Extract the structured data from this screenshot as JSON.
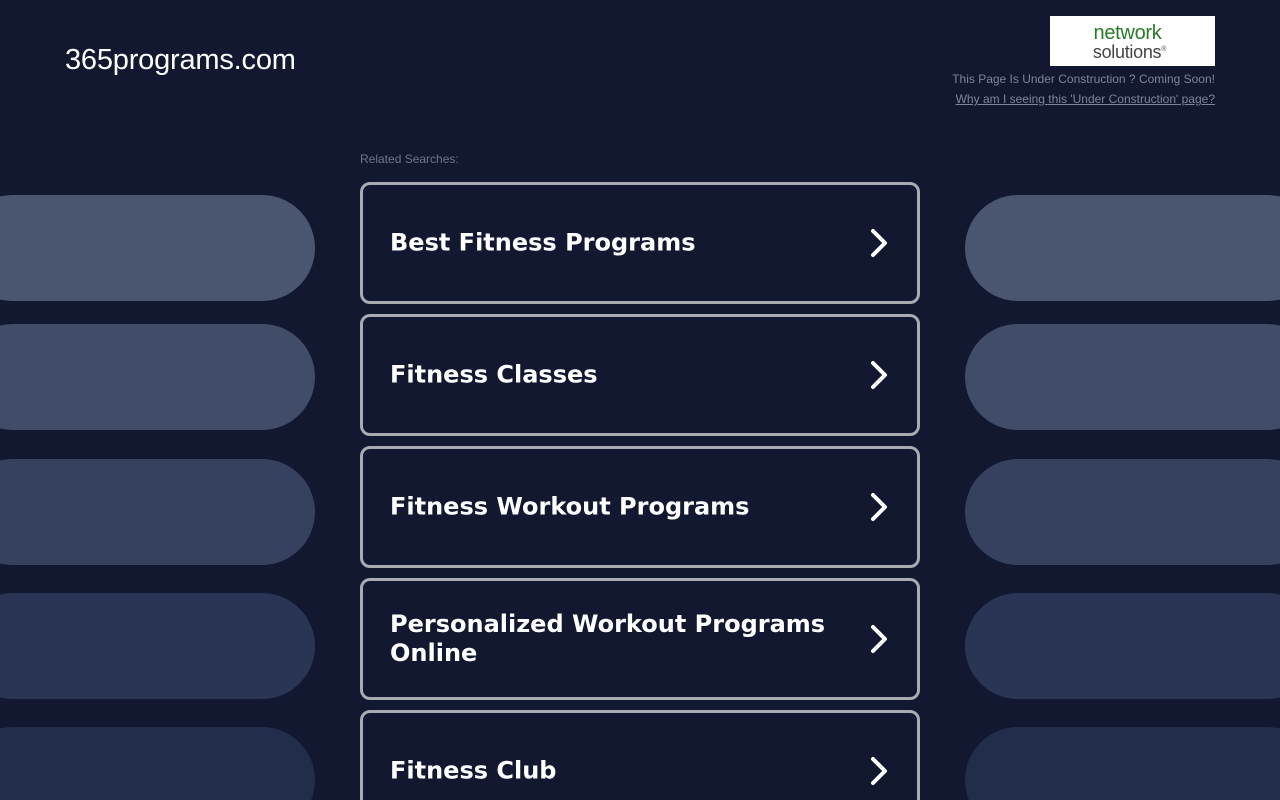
{
  "header": {
    "domain": "365programs.com",
    "logo": {
      "line1": "network",
      "line2": "solutions",
      "mark": "®"
    },
    "under_construction": "This Page Is Under Construction ? Coming Soon!",
    "why_link": "Why am I seeing this 'Under Construction' page?"
  },
  "related_label": "Related Searches:",
  "results": [
    {
      "label": "Best Fitness Programs",
      "icon": "chevron-right-icon"
    },
    {
      "label": "Fitness Classes",
      "icon": "chevron-right-icon"
    },
    {
      "label": "Fitness Workout Programs",
      "icon": "chevron-right-icon"
    },
    {
      "label": "Personalized Workout Programs Online",
      "icon": "chevron-right-icon"
    },
    {
      "label": "Fitness Club",
      "icon": "chevron-right-icon"
    }
  ],
  "colors": {
    "background": "#111830",
    "border": "#a9abb2",
    "text": "#ffffff",
    "muted": "#7f8598",
    "logo_green": "#2a7a2a"
  }
}
